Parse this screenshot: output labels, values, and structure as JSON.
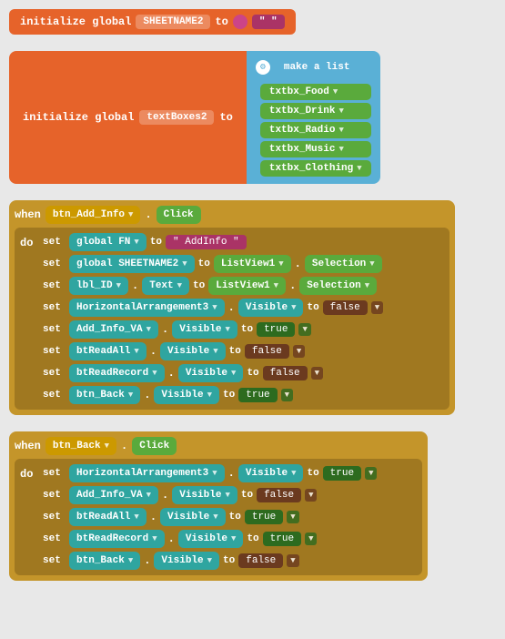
{
  "blocks": {
    "init1": {
      "keyword": "initialize global",
      "varName": "SHEETNAME2",
      "to": "to",
      "value": "\" \""
    },
    "init2": {
      "keyword": "initialize global",
      "varName": "textBoxes2",
      "to": "to",
      "makeList": "make a list",
      "items": [
        "txtbx_Food",
        "txtbx_Drink",
        "txtbx_Radio",
        "txtbx_Music",
        "txtbx_Clothing"
      ]
    },
    "when1": {
      "when": "when",
      "component": "btn_Add_Info",
      "event": "Click",
      "do": "do",
      "rows": [
        {
          "set": "set",
          "target": "global FN",
          "dot": ".",
          "prop": null,
          "to": "to",
          "value": "\" AddInfo \""
        },
        {
          "set": "set",
          "target": "global SHEETNAME2",
          "dot": ".",
          "prop": null,
          "to": "to",
          "source": "ListView1",
          "sourceProp": "Selection"
        },
        {
          "set": "set",
          "target": "lbl_ID",
          "dot": ".",
          "prop": "Text",
          "to": "to",
          "source": "ListView1",
          "sourceProp": "Selection"
        },
        {
          "set": "set",
          "target": "HorizontalArrangement3",
          "dot": ".",
          "prop": "Visible",
          "to": "to",
          "value": "false"
        },
        {
          "set": "set",
          "target": "Add_Info_VA",
          "dot": ".",
          "prop": "Visible",
          "to": "to",
          "value": "true"
        },
        {
          "set": "set",
          "target": "btReadAll",
          "dot": ".",
          "prop": "Visible",
          "to": "to",
          "value": "false"
        },
        {
          "set": "set",
          "target": "btReadRecord",
          "dot": ".",
          "prop": "Visible",
          "to": "to",
          "value": "false"
        },
        {
          "set": "set",
          "target": "btn_Back",
          "dot": ".",
          "prop": "Visible",
          "to": "to",
          "value": "true"
        }
      ]
    },
    "when2": {
      "when": "when",
      "component": "btn_Back",
      "event": "Click",
      "do": "do",
      "rows": [
        {
          "set": "set",
          "target": "HorizontalArrangement3",
          "dot": ".",
          "prop": "Visible",
          "to": "to",
          "value": "true"
        },
        {
          "set": "set",
          "target": "Add_Info_VA",
          "dot": ".",
          "prop": "Visible",
          "to": "to",
          "value": "false"
        },
        {
          "set": "set",
          "target": "btReadAll",
          "dot": ".",
          "prop": "Visible",
          "to": "to",
          "value": "true"
        },
        {
          "set": "set",
          "target": "btReadRecord",
          "dot": ".",
          "prop": "Visible",
          "to": "to",
          "value": "true"
        },
        {
          "set": "set",
          "target": "btn_Back",
          "dot": ".",
          "prop": "Visible",
          "to": "to",
          "value": "false"
        }
      ]
    }
  }
}
